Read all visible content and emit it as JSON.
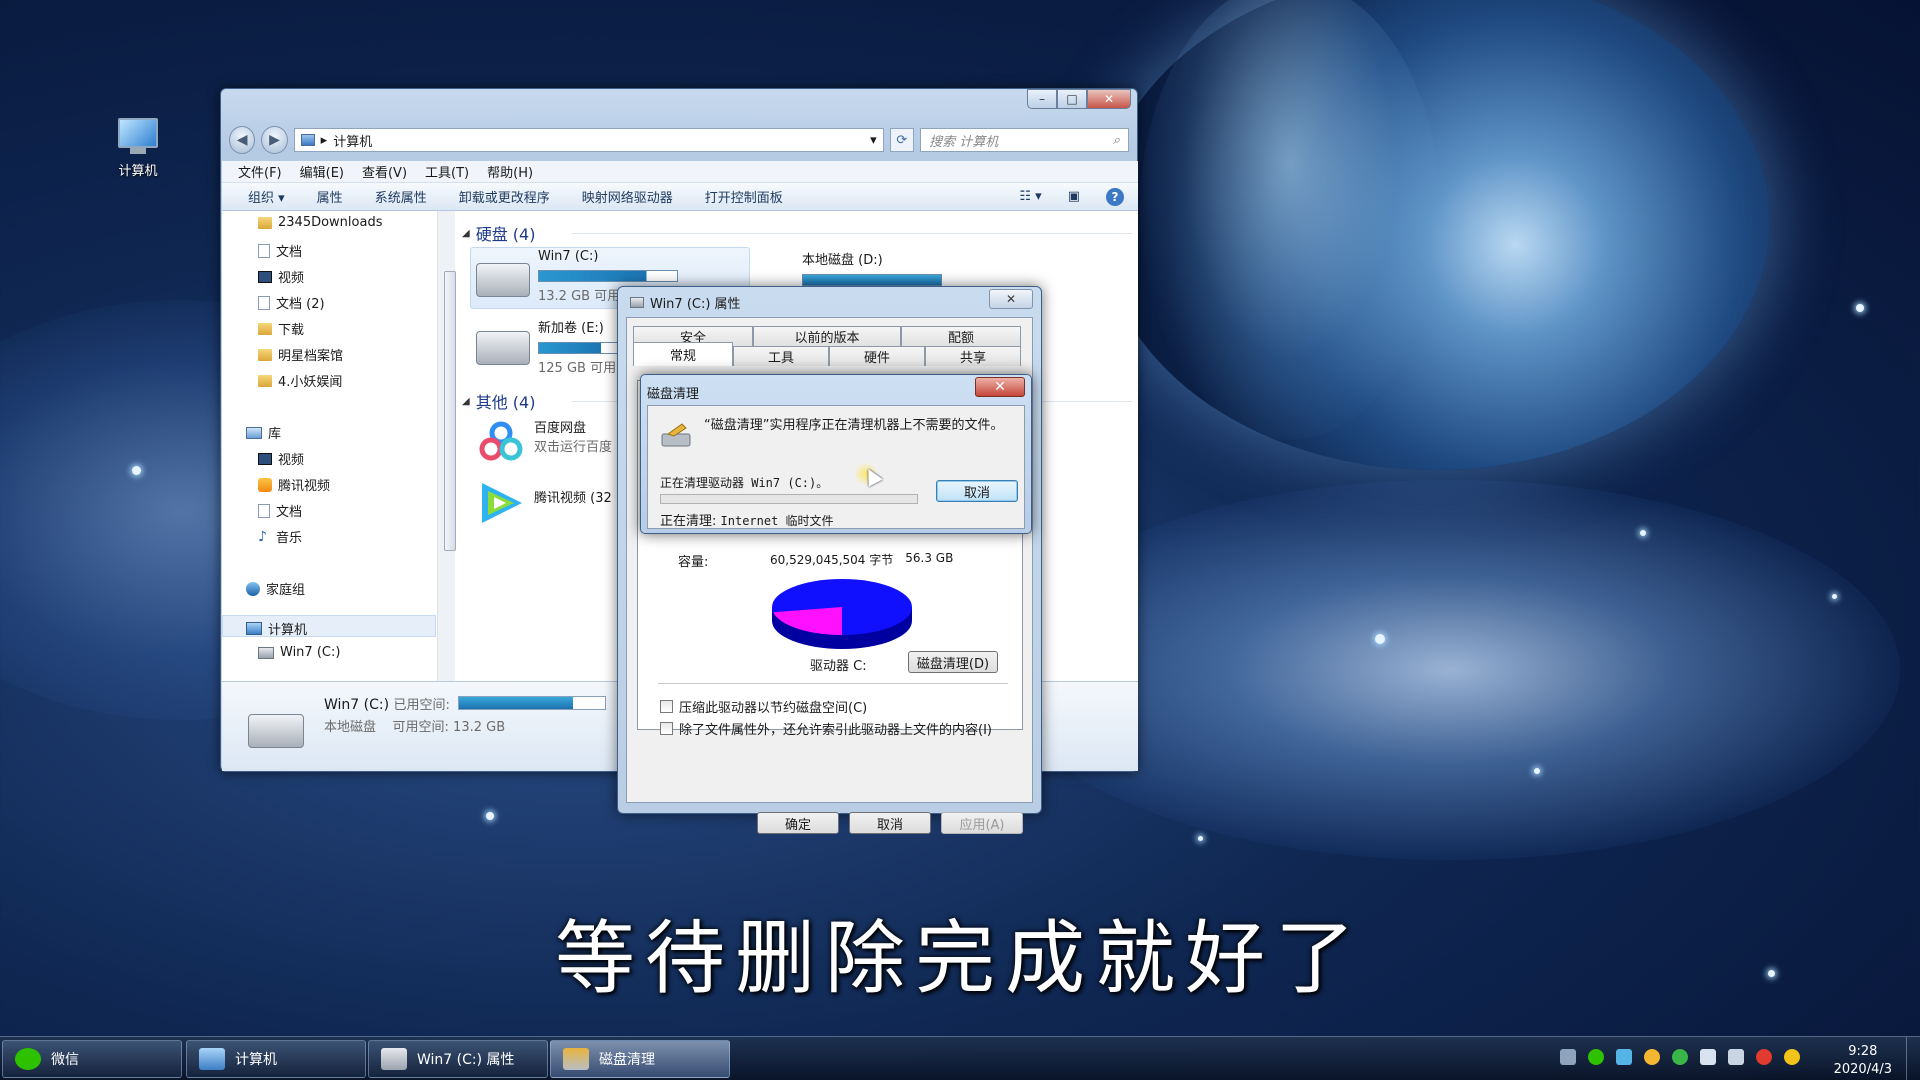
{
  "desktop": {
    "icon_label": "计算机",
    "subtitle": "等待删除完成就好了"
  },
  "explorer": {
    "address": {
      "location": "计算机"
    },
    "search_placeholder": "搜索 计算机",
    "menu": [
      "文件(F)",
      "编辑(E)",
      "查看(V)",
      "工具(T)",
      "帮助(H)"
    ],
    "commands": [
      "组织 ▾",
      "属性",
      "系统属性",
      "卸载或更改程序",
      "映射网络驱动器",
      "打开控制面板"
    ],
    "sidebar": {
      "items": [
        "2345Downloads",
        "文档",
        "视频",
        "文档 (2)",
        "下载",
        "明星档案馆",
        "4.小妖娱闻",
        "库",
        "视频",
        "腾讯视频",
        "文档",
        "音乐",
        "家庭组",
        "计算机",
        "Win7 (C:)"
      ]
    },
    "groups": {
      "hard_disks": "硬盘 (4)",
      "other": "其他 (4)"
    },
    "drives": [
      {
        "name": "Win7 (C:)",
        "free": "13.2 GB 可用",
        "used_fraction": 0.78
      },
      {
        "name": "本地磁盘 (D:)"
      },
      {
        "name": "新加卷 (E:)",
        "free": "125 GB 可用",
        "used_fraction": 0.45
      }
    ],
    "others": [
      {
        "name": "百度网盘",
        "sub": "双击运行百度"
      },
      {
        "name": "腾讯视频 (32"
      }
    ],
    "status": {
      "drive": "Win7 (C:)",
      "used_label": "已用空间:",
      "type": "本地磁盘",
      "free_label": "可用空间: 13.2 GB",
      "used_fraction": 0.78
    }
  },
  "properties": {
    "title": "Win7 (C:) 属性",
    "tabs_top": [
      "安全",
      "以前的版本",
      "配额"
    ],
    "tabs_bottom": [
      "常规",
      "工具",
      "硬件",
      "共享"
    ],
    "capacity_label": "容量:",
    "capacity_bytes": "60,529,045,504 字节",
    "capacity_gb": "56.3 GB",
    "drive_label": "驱动器 C:",
    "cleanup_button": "磁盘清理(D)",
    "compress_option": "压缩此驱动器以节约磁盘空间(C)",
    "index_option": "除了文件属性外，还允许索引此驱动器上文件的内容(I)",
    "ok": "确定",
    "cancel": "取消",
    "apply": "应用(A)",
    "pie": {
      "used_fraction": 0.78,
      "used_color": "#1010ff",
      "free_color": "#ff10ff"
    }
  },
  "cleanup": {
    "title": "磁盘清理",
    "message": "“磁盘清理”实用程序正在清理机器上不需要的文件。",
    "drive_line": "正在清理驱动器 Win7 (C:)。",
    "cancel": "取消",
    "current_label": "正在清理:",
    "current_item": "Internet 临时文件"
  },
  "taskbar": {
    "tasks": [
      "微信",
      "计算机",
      "Win7 (C:) 属性",
      "磁盘清理"
    ],
    "time": "9:28",
    "date": "2020/4/3"
  }
}
